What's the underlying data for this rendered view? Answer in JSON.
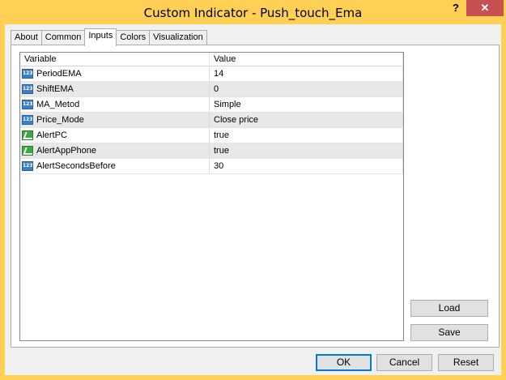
{
  "window": {
    "title": "Custom Indicator - Push_touch_Ema",
    "help_glyph": "?",
    "close_glyph": "✕",
    "accent": "#ffcf56",
    "close_color": "#c75050"
  },
  "tabs": [
    {
      "label": "About",
      "active": false
    },
    {
      "label": "Common",
      "active": false
    },
    {
      "label": "Inputs",
      "active": true
    },
    {
      "label": "Colors",
      "active": false
    },
    {
      "label": "Visualization",
      "active": false
    }
  ],
  "grid": {
    "headers": {
      "variable": "Variable",
      "value": "Value"
    },
    "rows": [
      {
        "icon": "number-icon",
        "variable": "PeriodEMA",
        "value": "14"
      },
      {
        "icon": "number-icon",
        "variable": "ShiftEMA",
        "value": "0"
      },
      {
        "icon": "number-icon",
        "variable": "MA_Metod",
        "value": "Simple"
      },
      {
        "icon": "number-icon",
        "variable": "Price_Mode",
        "value": "Close price"
      },
      {
        "icon": "boolean-icon",
        "variable": "AlertPC",
        "value": "true"
      },
      {
        "icon": "boolean-icon",
        "variable": "AlertAppPhone",
        "value": "true"
      },
      {
        "icon": "number-icon",
        "variable": "AlertSecondsBefore",
        "value": "30"
      }
    ],
    "number_icon_text": "123"
  },
  "buttons": {
    "load": "Load",
    "save": "Save",
    "ok": "OK",
    "cancel": "Cancel",
    "reset": "Reset"
  }
}
